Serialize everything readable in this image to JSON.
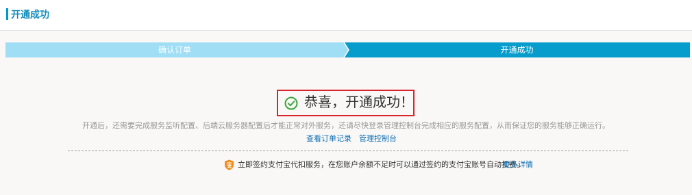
{
  "header": {
    "title": "开通成功"
  },
  "steps": [
    {
      "label": "确认订单",
      "state": "completed",
      "color": "#9fdef5"
    },
    {
      "label": "开通成功",
      "state": "current",
      "color": "#069ccc"
    }
  ],
  "result": {
    "icon": "check-circle-icon",
    "icon_color": "#3aa53a",
    "message": "恭喜，开通成功！",
    "description": "开通后，还需要完成服务监听配置、后端云服务器配置后才能正常对外服务，还请尽快登录管理控制台完成相应的服务配置，从而保证您的服务能够正确运行。"
  },
  "links": {
    "orders": "查看订单记录",
    "console": "管理控制台"
  },
  "alipay": {
    "icon": "alipay-shield-icon",
    "icon_color": "#f08c1e",
    "text": "立即签约支付宝代扣服务，在您账户余额不足时可以通过签约的支付宝账号自动扣费。",
    "more_link": "更多详情"
  },
  "colors": {
    "accent": "#0e8cba",
    "link": "#0e6fb3",
    "highlight_border": "#d9232d",
    "panel_bg": "#f9f8f7"
  }
}
